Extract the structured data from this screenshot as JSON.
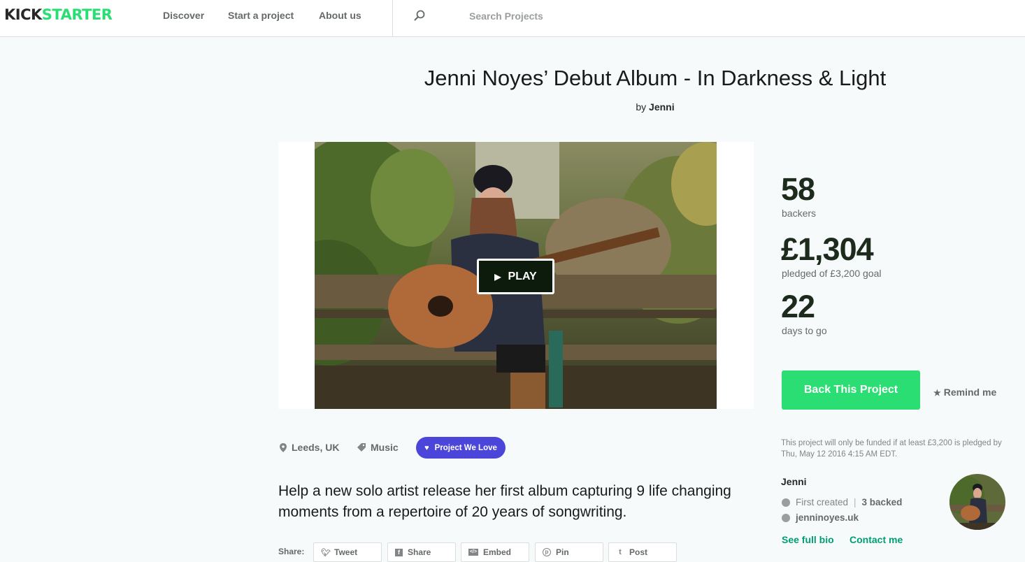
{
  "brand": {
    "part1": "KICK",
    "part2": "STARTER"
  },
  "nav": {
    "discover": "Discover",
    "start": "Start a project",
    "about": "About us",
    "search_placeholder": "Search Projects"
  },
  "project": {
    "title": "Jenni Noyes’ Debut Album - In Darkness & Light",
    "by_prefix": "by",
    "creator": "Jenni",
    "play_label": "PLAY",
    "location": "Leeds, UK",
    "category": "Music",
    "badge": "Project We Love",
    "blurb": "Help a new solo artist release her first album capturing 9 life changing moments from a repertoire of 20 years of songwriting."
  },
  "stats": {
    "backers": "58",
    "backers_label": "backers",
    "pledged": "£1,304",
    "pledged_label": "pledged of £3,200 goal",
    "days": "22",
    "days_label": "days to go"
  },
  "actions": {
    "back_label": "Back This Project",
    "remind_label": "Remind me",
    "funding_note": "This project will only be funded if at least £3,200 is pledged by Thu, May 12 2016 4:15 AM EDT."
  },
  "creator": {
    "name": "Jenni",
    "first_created": "First created",
    "backed": "3 backed",
    "website": "jenninoyes.uk",
    "bio_link": "See full bio",
    "contact_link": "Contact me"
  },
  "share": {
    "label": "Share:",
    "tweet": "Tweet",
    "share": "Share",
    "embed": "Embed",
    "pin": "Pin",
    "post": "Post"
  },
  "colors": {
    "brand_green": "#2bde73",
    "link_green": "#009e74",
    "badge_purple": "#4c45d9"
  }
}
